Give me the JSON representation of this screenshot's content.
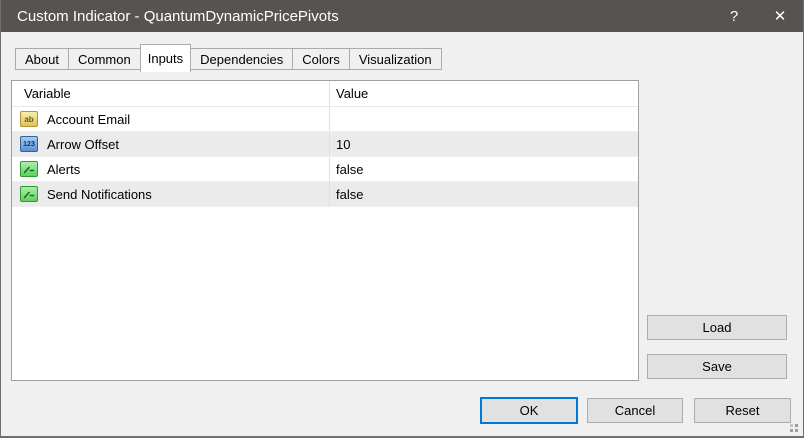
{
  "window": {
    "title": "Custom Indicator - QuantumDynamicPricePivots",
    "help_icon": "?",
    "close_icon": "✕"
  },
  "tabs": {
    "items": [
      {
        "label": "About",
        "active": false
      },
      {
        "label": "Common",
        "active": false
      },
      {
        "label": "Inputs",
        "active": true
      },
      {
        "label": "Dependencies",
        "active": false
      },
      {
        "label": "Colors",
        "active": false
      },
      {
        "label": "Visualization",
        "active": false
      }
    ]
  },
  "inputs_table": {
    "columns": [
      "Variable",
      "Value"
    ],
    "rows": [
      {
        "icon": "string-input-icon",
        "icon_text": "ab",
        "label": "Account Email",
        "value": ""
      },
      {
        "icon": "number-input-icon",
        "icon_text": "123",
        "label": "Arrow Offset",
        "value": "10"
      },
      {
        "icon": "bool-input-icon",
        "icon_text": "",
        "label": "Alerts",
        "value": "false"
      },
      {
        "icon": "bool-input-icon",
        "icon_text": "",
        "label": "Send Notifications",
        "value": "false"
      }
    ]
  },
  "side_buttons": {
    "load": "Load",
    "save": "Save"
  },
  "bottom_buttons": {
    "ok": "OK",
    "cancel": "Cancel",
    "reset": "Reset"
  },
  "colors": {
    "titlebar_bg": "#575350",
    "dialog_bg": "#f0f0f0",
    "focus_accent": "#0078d7",
    "zebra_row_bg": "#ebebeb",
    "table_border": "#9f9f9f",
    "button_bg": "#e1e1e1",
    "button_border": "#adadad"
  }
}
